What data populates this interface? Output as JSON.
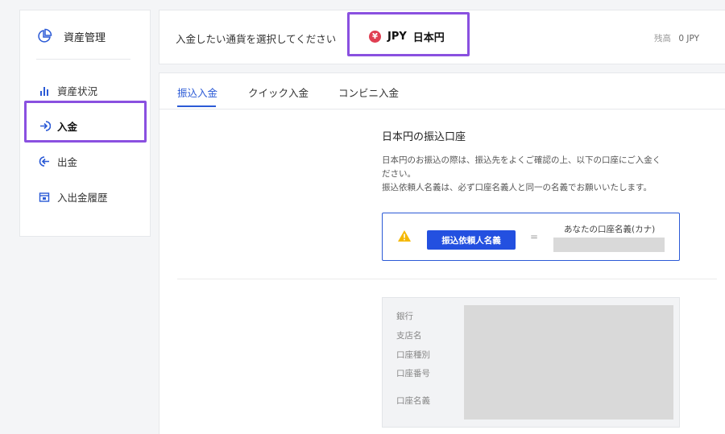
{
  "sidebar": {
    "header": "資産管理",
    "items": [
      {
        "label": "資産状況",
        "icon": "bar-chart-icon",
        "active": false
      },
      {
        "label": "入金",
        "icon": "deposit-arrow-icon",
        "active": true
      },
      {
        "label": "出金",
        "icon": "withdraw-arrow-icon",
        "active": false
      },
      {
        "label": "入出金履歴",
        "icon": "history-icon",
        "active": false
      }
    ]
  },
  "currency_bar": {
    "prompt": "入金したい通貨を選択してください",
    "selected_code": "JPY",
    "selected_name": "日本円",
    "currency_icon": "¥",
    "balance_label": "残高",
    "balance_value": "0 JPY"
  },
  "tabs": [
    {
      "label": "振込入金",
      "active": true
    },
    {
      "label": "クイック入金",
      "active": false
    },
    {
      "label": "コンビニ入金",
      "active": false
    }
  ],
  "content": {
    "title": "日本円の振込口座",
    "desc_line1": "日本円のお振込の際は、振込先をよくご確認の上、以下の口座にご入金く",
    "desc_line2": "ださい。",
    "desc_line3": "振込依頼人名義は、必ず口座名義人と同一の名義でお願いいたします。",
    "notice": {
      "button_label": "振込依頼人名義",
      "equals": "=",
      "account_label": "あなたの口座名義(カナ)"
    },
    "bank_fields": [
      "銀行",
      "支店名",
      "口座種別",
      "口座番号",
      "口座名義"
    ]
  },
  "colors": {
    "accent": "#2b5ad6",
    "highlight": "#8a50e0",
    "yen_badge": "#e03e52"
  }
}
